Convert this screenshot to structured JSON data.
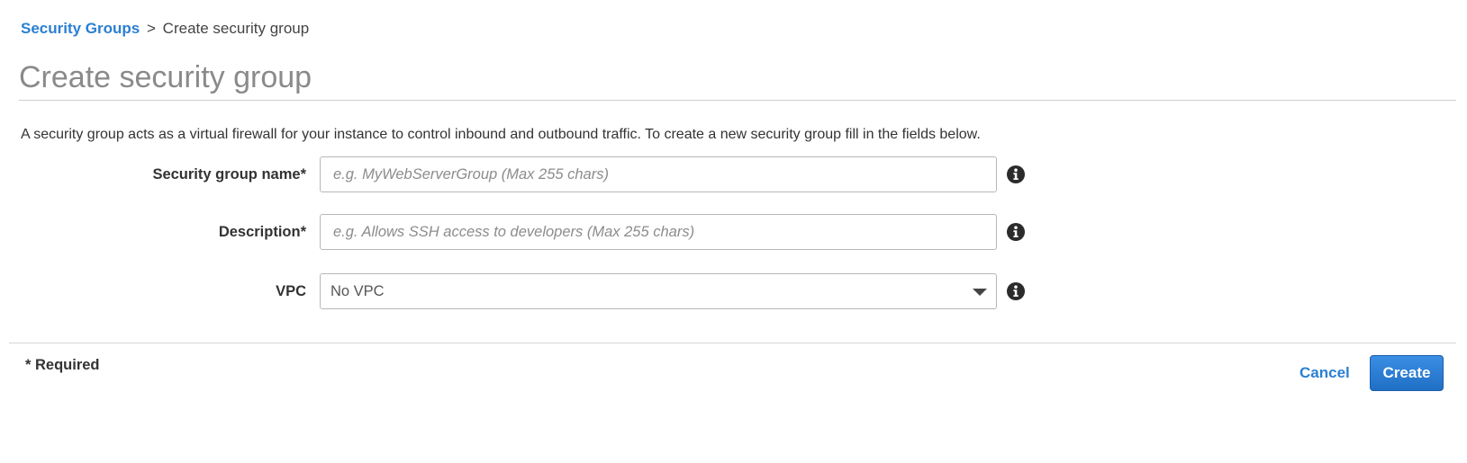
{
  "breadcrumb": {
    "parent_label": "Security Groups",
    "separator": ">",
    "current_label": "Create security group"
  },
  "page": {
    "title": "Create security group",
    "intro": "A security group acts as a virtual firewall for your instance to control inbound and outbound traffic. To create a new security group fill in the fields below."
  },
  "form": {
    "name": {
      "label": "Security group name*",
      "value": "",
      "placeholder": "e.g. MyWebServerGroup (Max 255 chars)",
      "info_icon": "info-circle-icon"
    },
    "description": {
      "label": "Description*",
      "value": "",
      "placeholder": "e.g. Allows SSH access to developers (Max 255 chars)",
      "info_icon": "info-circle-icon"
    },
    "vpc": {
      "label": "VPC",
      "selected": "No VPC",
      "dropdown_icon": "caret-down-icon",
      "info_icon": "info-circle-icon"
    }
  },
  "footer": {
    "required_note": "* Required",
    "cancel_label": "Cancel",
    "create_label": "Create"
  },
  "colors": {
    "link": "#2a7fd2",
    "primary_button": "#1f6fc5",
    "title_gray": "#8a8a8a",
    "text": "#333333"
  }
}
